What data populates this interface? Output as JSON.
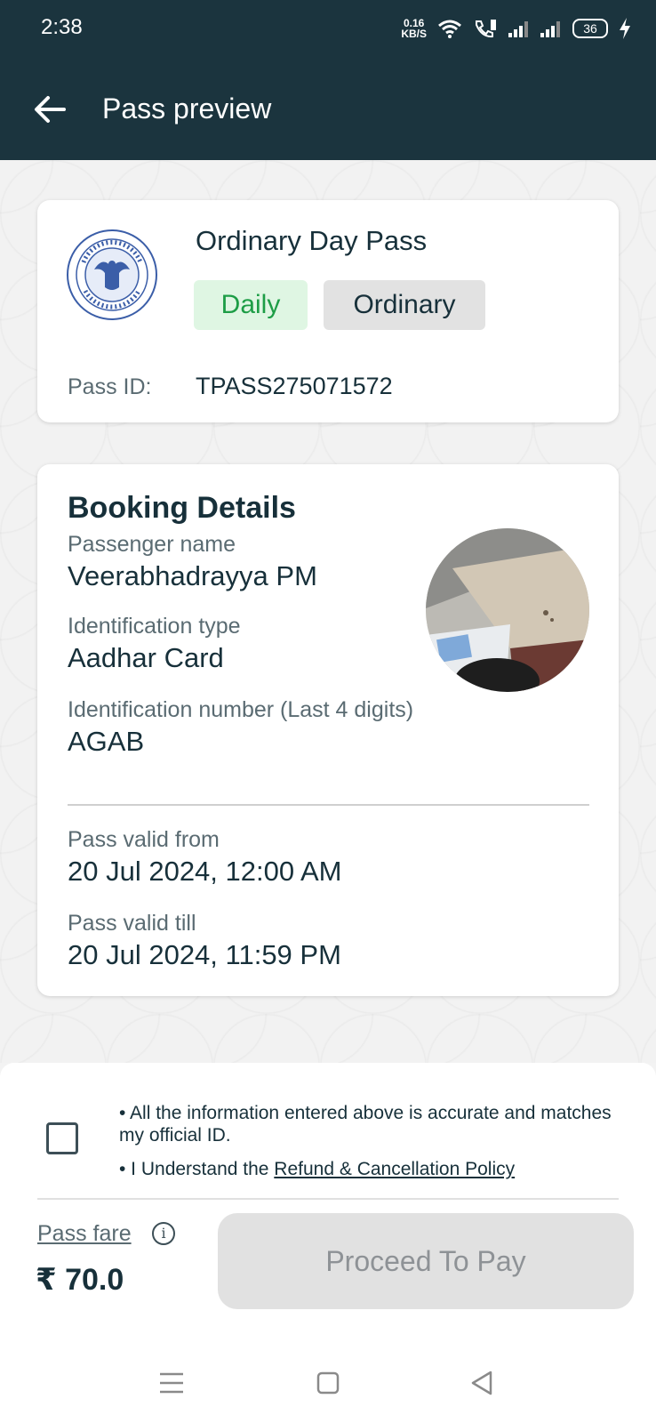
{
  "status_bar": {
    "time": "2:38",
    "net_speed_value": "0.16",
    "net_speed_unit": "KB/S",
    "battery": "36",
    "icons": [
      "wifi-icon",
      "volte-call-icon",
      "signal-1-icon",
      "signal-2-icon",
      "battery-icon",
      "charging-icon"
    ]
  },
  "app_bar": {
    "title": "Pass preview",
    "back_icon": "arrow-left-icon"
  },
  "pass_card": {
    "logo": "bmtc-logo",
    "name": "Ordinary Day Pass",
    "tags": [
      "Daily",
      "Ordinary"
    ],
    "pass_id_label": "Pass ID:",
    "pass_id_value": "TPASS275071572"
  },
  "booking": {
    "title": "Booking Details",
    "passenger_label": "Passenger name",
    "passenger_value": "Veerabhadrayya PM",
    "id_type_label": "Identification type",
    "id_type_value": "Aadhar Card",
    "id_number_label": "Identification number (Last 4 digits)",
    "id_number_value": "AGAB",
    "valid_from_label": "Pass valid from",
    "valid_from_value": "20 Jul 2024, 12:00 AM",
    "valid_till_label": "Pass valid till",
    "valid_till_value": "20 Jul 2024, 11:59 PM"
  },
  "footer": {
    "consent_1": "• All the information entered above is accurate and matches my official ID.",
    "consent_2_prefix": "• I Understand the ",
    "consent_2_link": "Refund & Cancellation Policy",
    "checkbox_checked": false,
    "fare_label": "Pass fare",
    "fare_value": "₹ 70.0",
    "pay_button": "Proceed To Pay"
  },
  "nav": {
    "items": [
      "menu-icon",
      "home-square-icon",
      "back-triangle-icon"
    ]
  },
  "colors": {
    "header": "#1b343e",
    "daily_tag_bg": "#dff6e3",
    "daily_tag_text": "#1d9d46",
    "disabled_button": "#e1e1e1"
  }
}
